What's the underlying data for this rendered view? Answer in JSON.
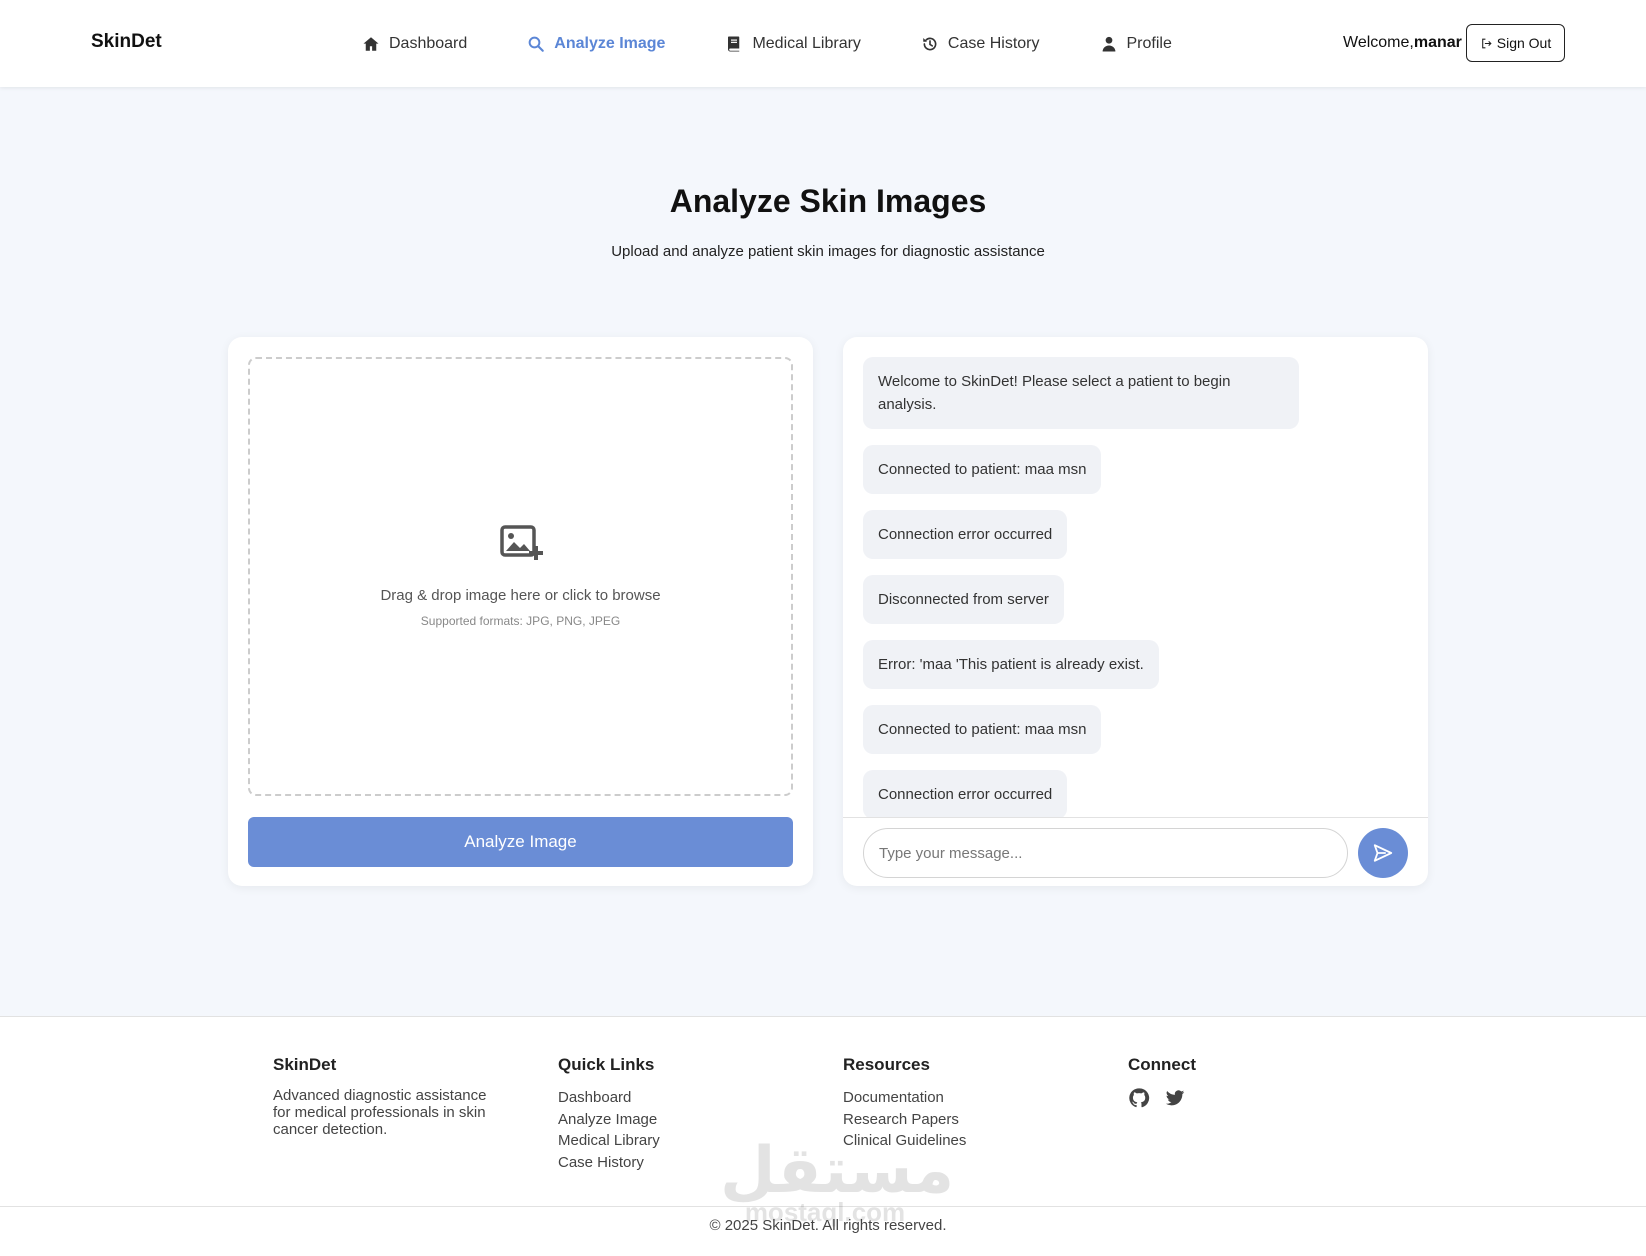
{
  "header": {
    "brand": "SkinDet",
    "nav": [
      {
        "label": "Dashboard",
        "icon": "home-icon"
      },
      {
        "label": "Analyze Image",
        "icon": "search-icon",
        "active": true
      },
      {
        "label": "Medical Library",
        "icon": "book-icon"
      },
      {
        "label": "Case History",
        "icon": "history-icon"
      },
      {
        "label": "Profile",
        "icon": "user-icon"
      }
    ],
    "welcome_prefix": "Welcome,",
    "username": "manar",
    "sign_out_label": "Sign Out"
  },
  "page": {
    "title": "Analyze Skin Images",
    "subtitle": "Upload and analyze patient skin images for diagnostic assistance"
  },
  "upload": {
    "drop_text": "Drag & drop image here or click to browse",
    "formats_text": "Supported formats: JPG, PNG, JPEG",
    "analyze_label": "Analyze Image"
  },
  "chat": {
    "messages": [
      "Welcome to SkinDet! Please select a patient to begin analysis.",
      "Connected to patient: maa msn",
      "Connection error occurred",
      "Disconnected from server",
      "Error: 'maa 'This patient is already exist.",
      "Connected to patient: maa msn",
      "Connection error occurred"
    ],
    "input_placeholder": "Type your message..."
  },
  "footer": {
    "brand": {
      "title": "SkinDet",
      "description": "Advanced diagnostic assistance for medical professionals in skin cancer detection."
    },
    "quick_links": {
      "title": "Quick Links",
      "links": [
        "Dashboard",
        "Analyze Image",
        "Medical Library",
        "Case History"
      ]
    },
    "resources": {
      "title": "Resources",
      "links": [
        "Documentation",
        "Research Papers",
        "Clinical Guidelines"
      ]
    },
    "connect": {
      "title": "Connect",
      "icons": [
        "github-icon",
        "twitter-icon"
      ]
    },
    "copyright": "© 2025 SkinDet. All rights reserved."
  },
  "watermark": {
    "arabic": "مستقل",
    "latin": "mostaql.com"
  },
  "colors": {
    "accent": "#6a8dd6",
    "active_nav": "#5b86d6",
    "page_bg": "#f4f7fc",
    "bubble_bg": "#f0f2f6"
  }
}
